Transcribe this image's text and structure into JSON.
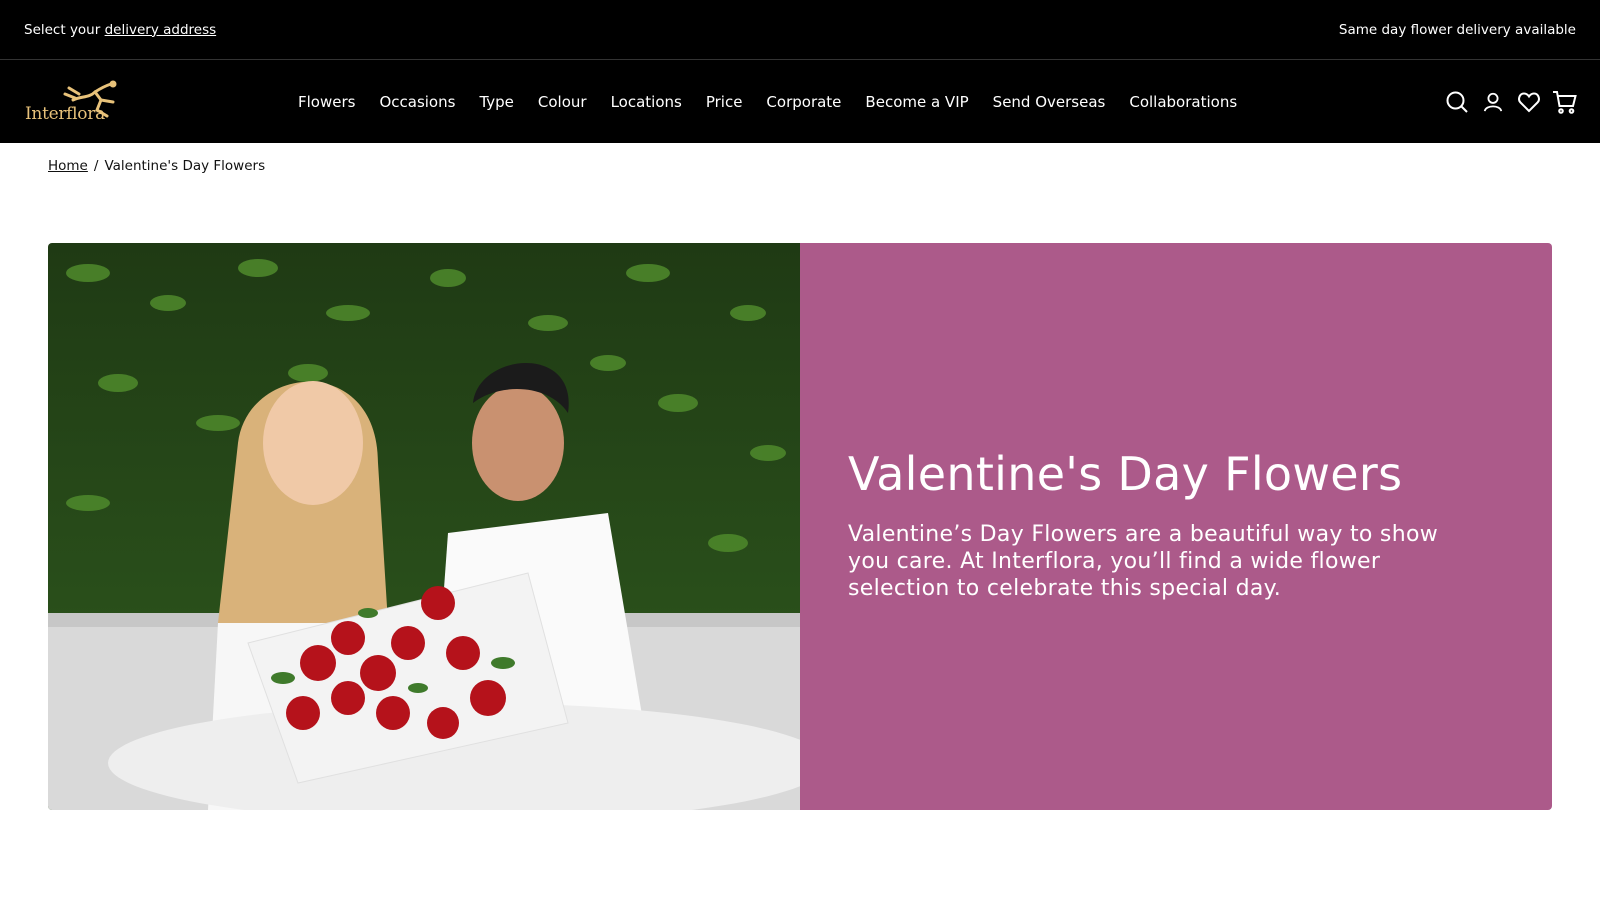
{
  "topbar": {
    "prefix": "Select your",
    "address_link": "delivery address",
    "promo": "Same day flower delivery available"
  },
  "brand": {
    "name": "Interflora",
    "color": "#e8c27a"
  },
  "nav": {
    "items": [
      {
        "label": "Flowers"
      },
      {
        "label": "Occasions"
      },
      {
        "label": "Type"
      },
      {
        "label": "Colour"
      },
      {
        "label": "Locations"
      },
      {
        "label": "Price"
      },
      {
        "label": "Corporate"
      },
      {
        "label": "Become a VIP"
      },
      {
        "label": "Send Overseas"
      },
      {
        "label": "Collaborations"
      }
    ]
  },
  "header_icons": [
    "search-icon",
    "account-icon",
    "wishlist-heart-icon",
    "cart-icon"
  ],
  "breadcrumb": {
    "home": "Home",
    "separator": "/",
    "current": "Valentine's Day Flowers"
  },
  "hero": {
    "title": "Valentine's Day Flowers",
    "description": "Valentine’s Day Flowers are a beautiful way to show you care. At Interflora, you’ll find a wide flower selection to celebrate this special day.",
    "panel_color": "#ac5a8a"
  }
}
